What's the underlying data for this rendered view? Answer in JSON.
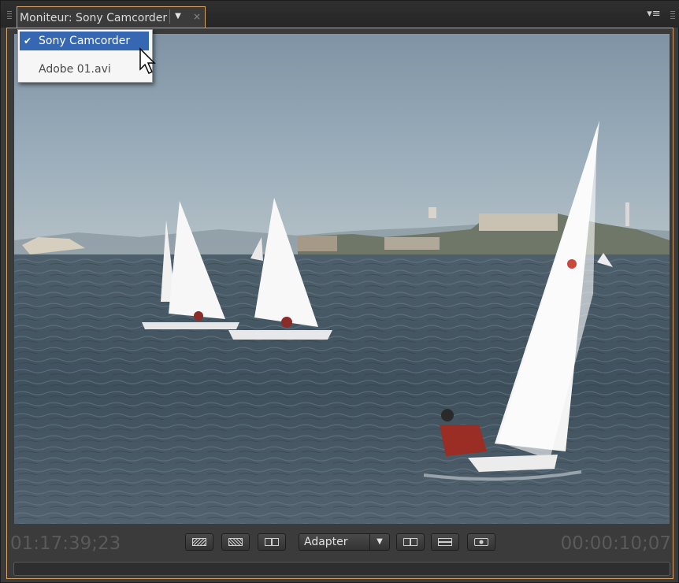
{
  "panel": {
    "tab_title": "Moniteur: Sony Camcorder",
    "tab_dropdown_arrow": "▼",
    "tab_close": "×",
    "panel_menu_icon": "▾≡"
  },
  "source_menu": {
    "items": [
      {
        "label": "Sony Camcorder",
        "checked": true
      },
      {
        "label": "Adobe 01.avi",
        "checked": false
      }
    ],
    "check_glyph": "✔"
  },
  "controls": {
    "current_time": "01:17:39;23",
    "duration": "00:00:10;07",
    "zoom": {
      "value": "Adapter",
      "arrow": "▼"
    },
    "buttons": [
      "safe-margins-icon",
      "output-mode-icon",
      "split-view-icon",
      "compare-view-icon",
      "fit-frame-icon",
      "camera-icon"
    ]
  },
  "colors": {
    "accent_border": "#d9a46a",
    "selection": "#3567b3",
    "timecode": "#5a5a5a"
  }
}
